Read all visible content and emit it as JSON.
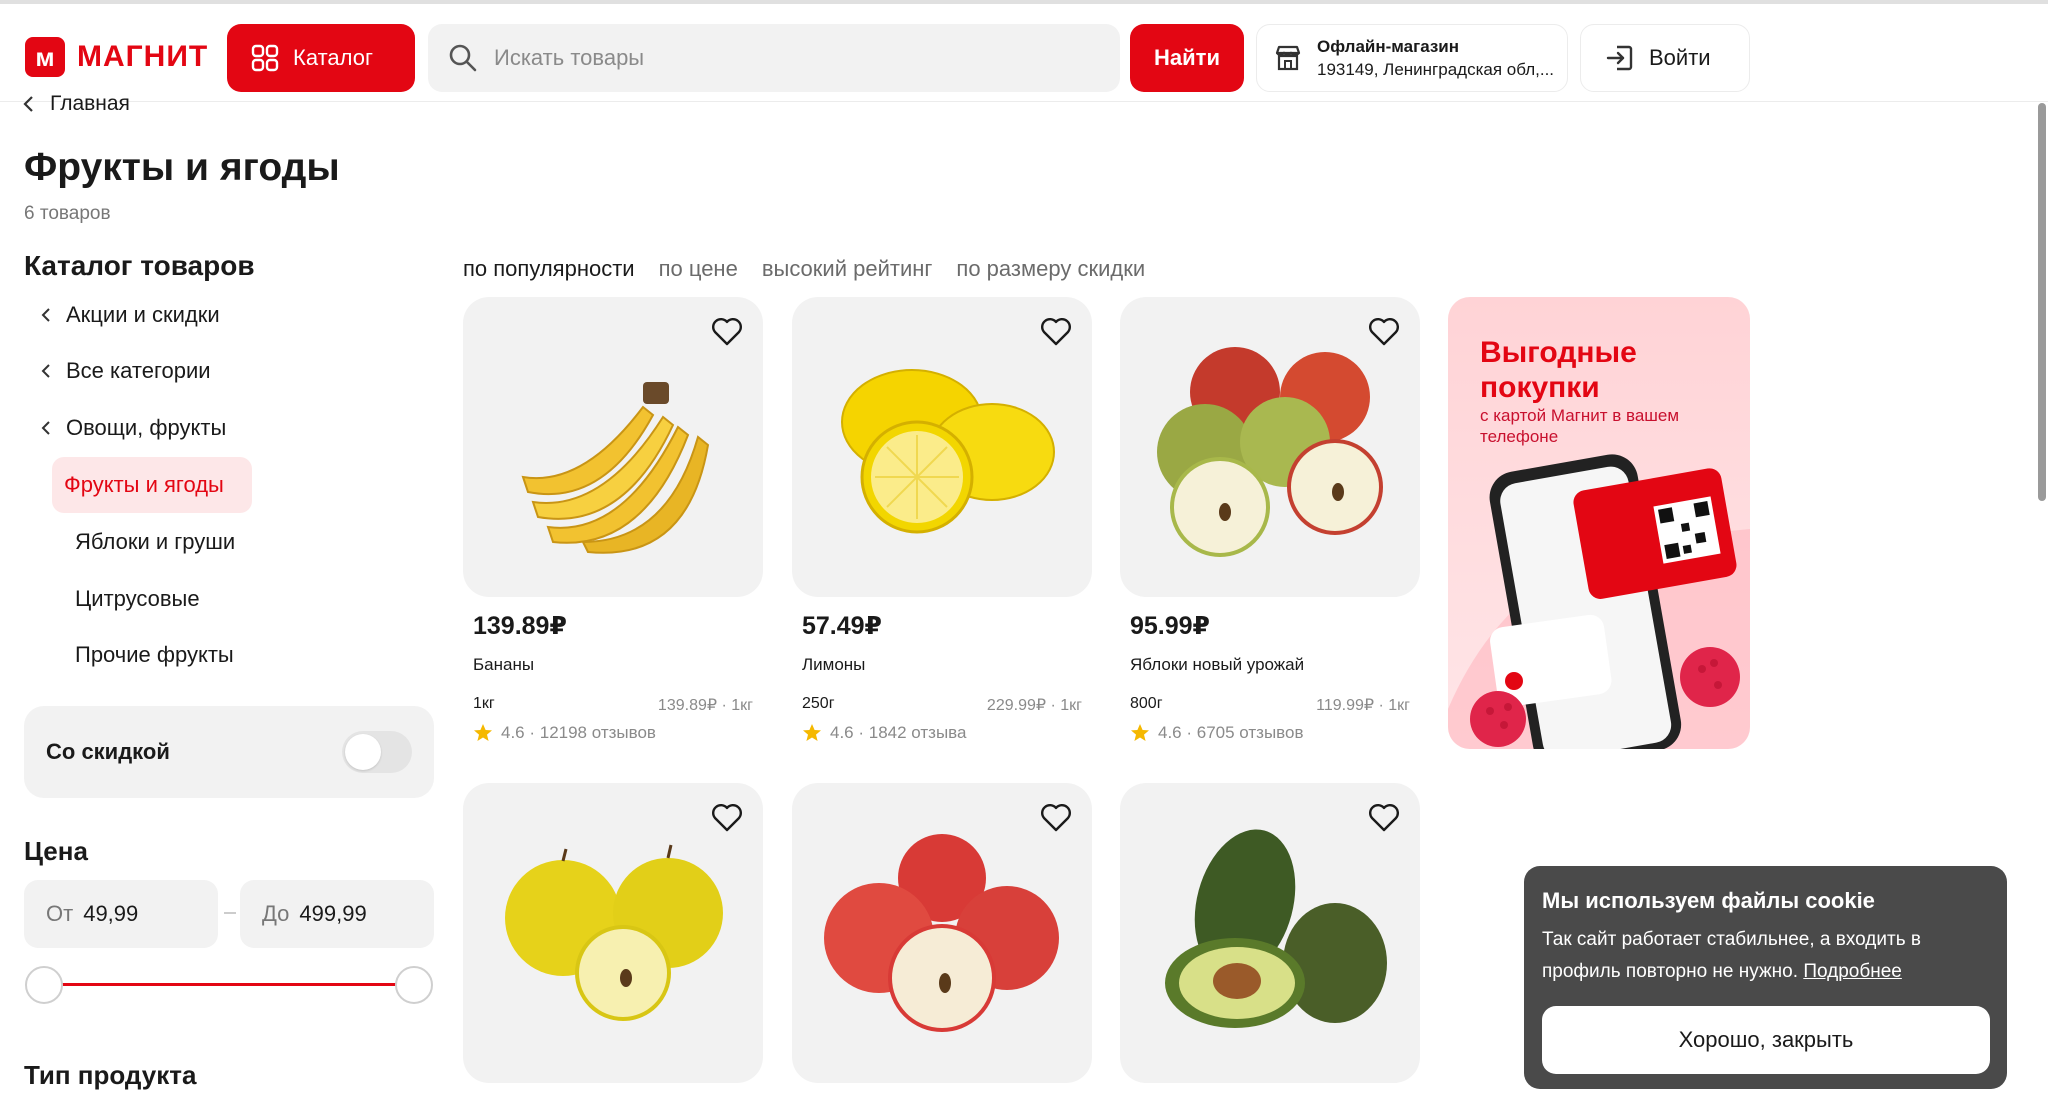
{
  "header": {
    "logo_mark": "м",
    "logo_text": "МАГНИТ",
    "catalog_label": "Каталог",
    "search_placeholder": "Искать товары",
    "find_label": "Найти",
    "store_title": "Офлайн-магазин",
    "store_address": "193149, Ленинградская обл,...",
    "login_label": "Войти"
  },
  "breadcrumb": {
    "label": "Главная"
  },
  "page": {
    "title": "Фрукты и ягоды",
    "count": "6 товаров"
  },
  "sidebar": {
    "heading": "Каталог товаров",
    "items": [
      {
        "label": "Акции и скидки"
      },
      {
        "label": "Все категории"
      },
      {
        "label": "Овощи, фрукты"
      }
    ],
    "active": "Фрукты и ягоды",
    "subitems": [
      {
        "label": "Яблоки и груши"
      },
      {
        "label": "Цитрусовые"
      },
      {
        "label": "Прочие фрукты"
      }
    ],
    "discount_label": "Со скидкой",
    "price_heading": "Цена",
    "price_from_label": "От",
    "price_from": "49,99",
    "price_to_label": "До",
    "price_to": "499,99",
    "type_heading": "Тип продукта"
  },
  "sort": [
    "по популярности",
    "по цене",
    "высокий рейтинг",
    "по размеру скидки"
  ],
  "products": [
    {
      "price": "139.89₽",
      "name": "Бананы",
      "weight": "1кг",
      "unit_price": "139.89₽ · 1кг",
      "rating": "4.6 · 12198 отзывов"
    },
    {
      "price": "57.49₽",
      "name": "Лимоны",
      "weight": "250г",
      "unit_price": "229.99₽ · 1кг",
      "rating": "4.6 · 1842 отзыва"
    },
    {
      "price": "95.99₽",
      "name": "Яблоки новый урожай",
      "weight": "800г",
      "unit_price": "119.99₽ · 1кг",
      "rating": "4.6 · 6705 отзывов"
    }
  ],
  "promo": {
    "title": "Выгодные покупки",
    "subtitle": "с картой Магнит в вашем телефоне"
  },
  "cookie": {
    "title": "Мы используем файлы cookie",
    "text": "Так сайт работает стабильнее, а входить в профиль повторно не нужно.",
    "link": "Подробнее",
    "button": "Хорошо, закрыть"
  },
  "colors": {
    "brand": "#e30613",
    "light_bg": "#f2f2f2",
    "active_bg": "#fde7e8",
    "star": "#f5b800"
  }
}
